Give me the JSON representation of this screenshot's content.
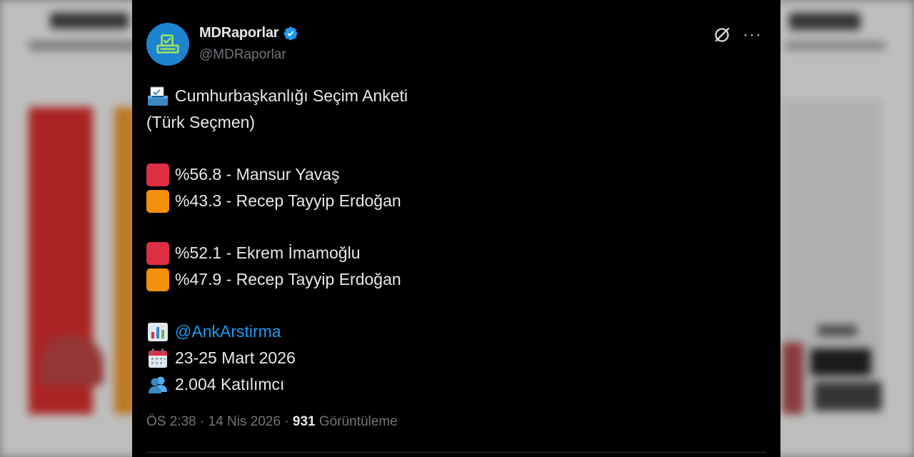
{
  "author": {
    "display_name": "MDRaporlar",
    "handle": "@MDRaporlar",
    "verified": true
  },
  "tweet": {
    "title_line1": "Cumhurbaşkanlığı Seçim Anketi",
    "title_line2": "(Türk Seçmen)",
    "matchups": [
      [
        {
          "color": "red",
          "text": "%56.8 - Mansur Yavaş"
        },
        {
          "color": "orange",
          "text": "%43.3 - Recep Tayyip Erdoğan"
        }
      ],
      [
        {
          "color": "red",
          "text": "%52.1 - Ekrem İmamoğlu"
        },
        {
          "color": "orange",
          "text": "%47.9 - Recep Tayyip Erdoğan"
        }
      ]
    ],
    "source_mention": "@AnkArstirma",
    "date_range": "23-25 Mart 2026",
    "participants": "2.004 Katılımcı"
  },
  "meta": {
    "time": "ÖS 2:38",
    "date": "14 Nis 2026",
    "views_count": "931",
    "views_label": "Görüntüleme",
    "separator": "·"
  },
  "icons": {
    "header_right": [
      "grok-icon",
      "more-icon"
    ],
    "title": "ballot-box-icon",
    "source": "bar-chart-icon",
    "date": "calendar-icon",
    "participants": "people-icon"
  },
  "colors": {
    "background": "#000000",
    "text": "#e7e9ea",
    "muted": "#71767b",
    "link": "#1d9bf0",
    "red_square": "#dd2e44",
    "orange_square": "#f4900c",
    "avatar": "#1d84cf"
  }
}
